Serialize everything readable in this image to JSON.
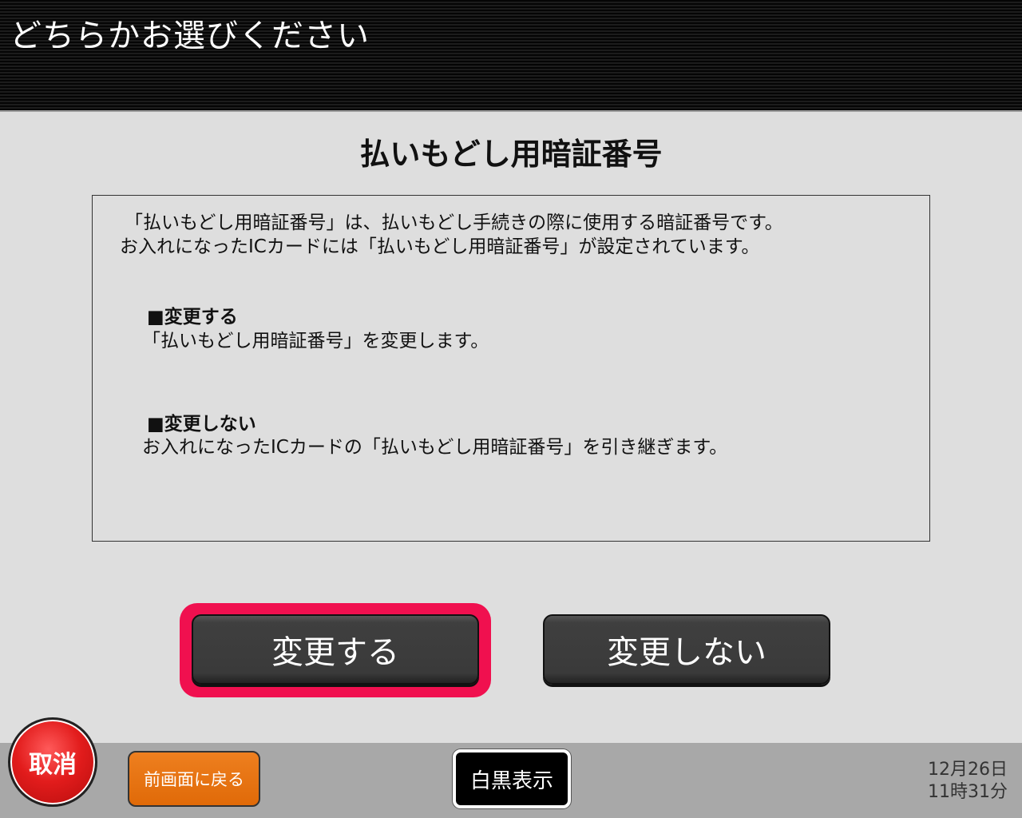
{
  "header": {
    "title": "どちらかお選びください"
  },
  "screen": {
    "title": "払いもどし用暗証番号"
  },
  "info": {
    "line1": "「払いもどし用暗証番号」は、払いもどし手続きの際に使用する暗証番号です。",
    "line2": "お入れになったICカードには「払いもどし用暗証番号」が設定されています。",
    "change_heading": "■変更する",
    "change_desc": "「払いもどし用暗証番号」を変更します。",
    "keep_heading": "■変更しない",
    "keep_desc": "お入れになったICカードの「払いもどし用暗証番号」を引き継ぎます。"
  },
  "options": {
    "change_label": "変更する",
    "keep_label": "変更しない"
  },
  "footer": {
    "cancel_label": "取消",
    "back_label": "前画面に戻る",
    "mono_label": "白黒表示",
    "date": "12月26日",
    "time": "11時31分"
  },
  "colors": {
    "selection_highlight": "#f0104f",
    "cancel": "#e21c1c",
    "back": "#e06a08"
  }
}
